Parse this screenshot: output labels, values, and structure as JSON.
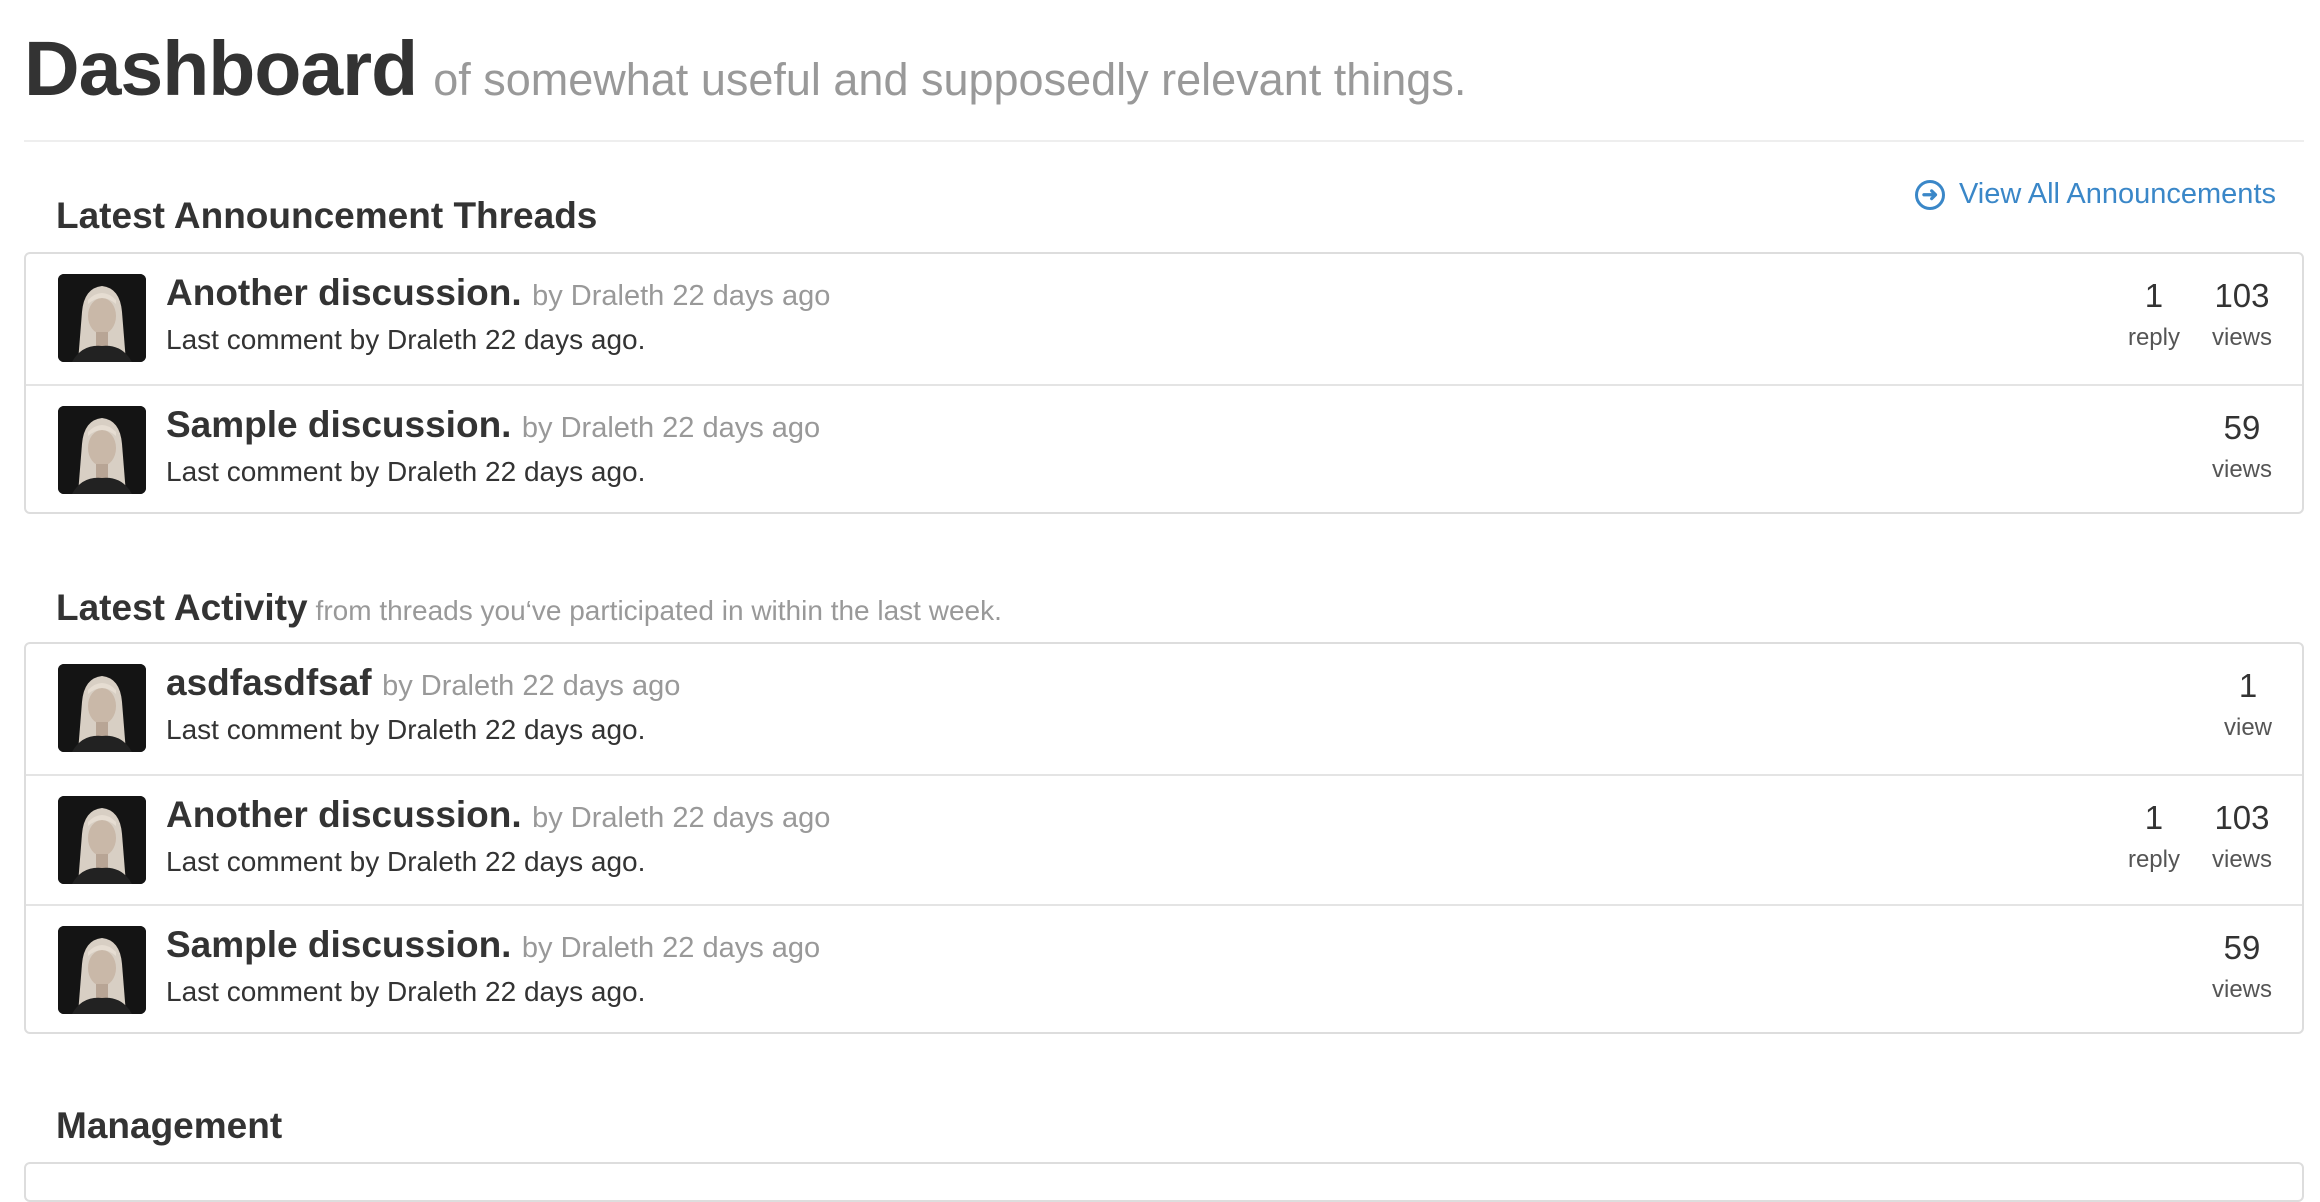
{
  "header": {
    "title": "Dashboard",
    "subtitle": "of somewhat useful and supposedly relevant things."
  },
  "announcements": {
    "title": "Latest Announcement Threads",
    "view_all_label": "View All Announcements",
    "threads": [
      {
        "title": "Another discussion.",
        "byline": "by Draleth 22 days ago",
        "last_comment": "Last comment by Draleth 22 days ago.",
        "replies": "1",
        "replies_label": "reply",
        "views": "103",
        "views_label": "views"
      },
      {
        "title": "Sample discussion.",
        "byline": "by Draleth 22 days ago",
        "last_comment": "Last comment by Draleth 22 days ago.",
        "views": "59",
        "views_label": "views"
      }
    ]
  },
  "activity": {
    "title": "Latest Activity",
    "subtitle": "from threads you‘ve participated in within the last week.",
    "threads": [
      {
        "title": "asdfasdfsaf",
        "byline": "by Draleth 22 days ago",
        "last_comment": "Last comment by Draleth 22 days ago.",
        "views": "1",
        "views_label": "view"
      },
      {
        "title": "Another discussion.",
        "byline": "by Draleth 22 days ago",
        "last_comment": "Last comment by Draleth 22 days ago.",
        "replies": "1",
        "replies_label": "reply",
        "views": "103",
        "views_label": "views"
      },
      {
        "title": "Sample discussion.",
        "byline": "by Draleth 22 days ago",
        "last_comment": "Last comment by Draleth 22 days ago.",
        "views": "59",
        "views_label": "views"
      }
    ]
  },
  "management": {
    "title": "Management"
  },
  "colors": {
    "text": "#333333",
    "muted": "#999999",
    "link": "#3a87c8",
    "border": "#dddddd"
  }
}
